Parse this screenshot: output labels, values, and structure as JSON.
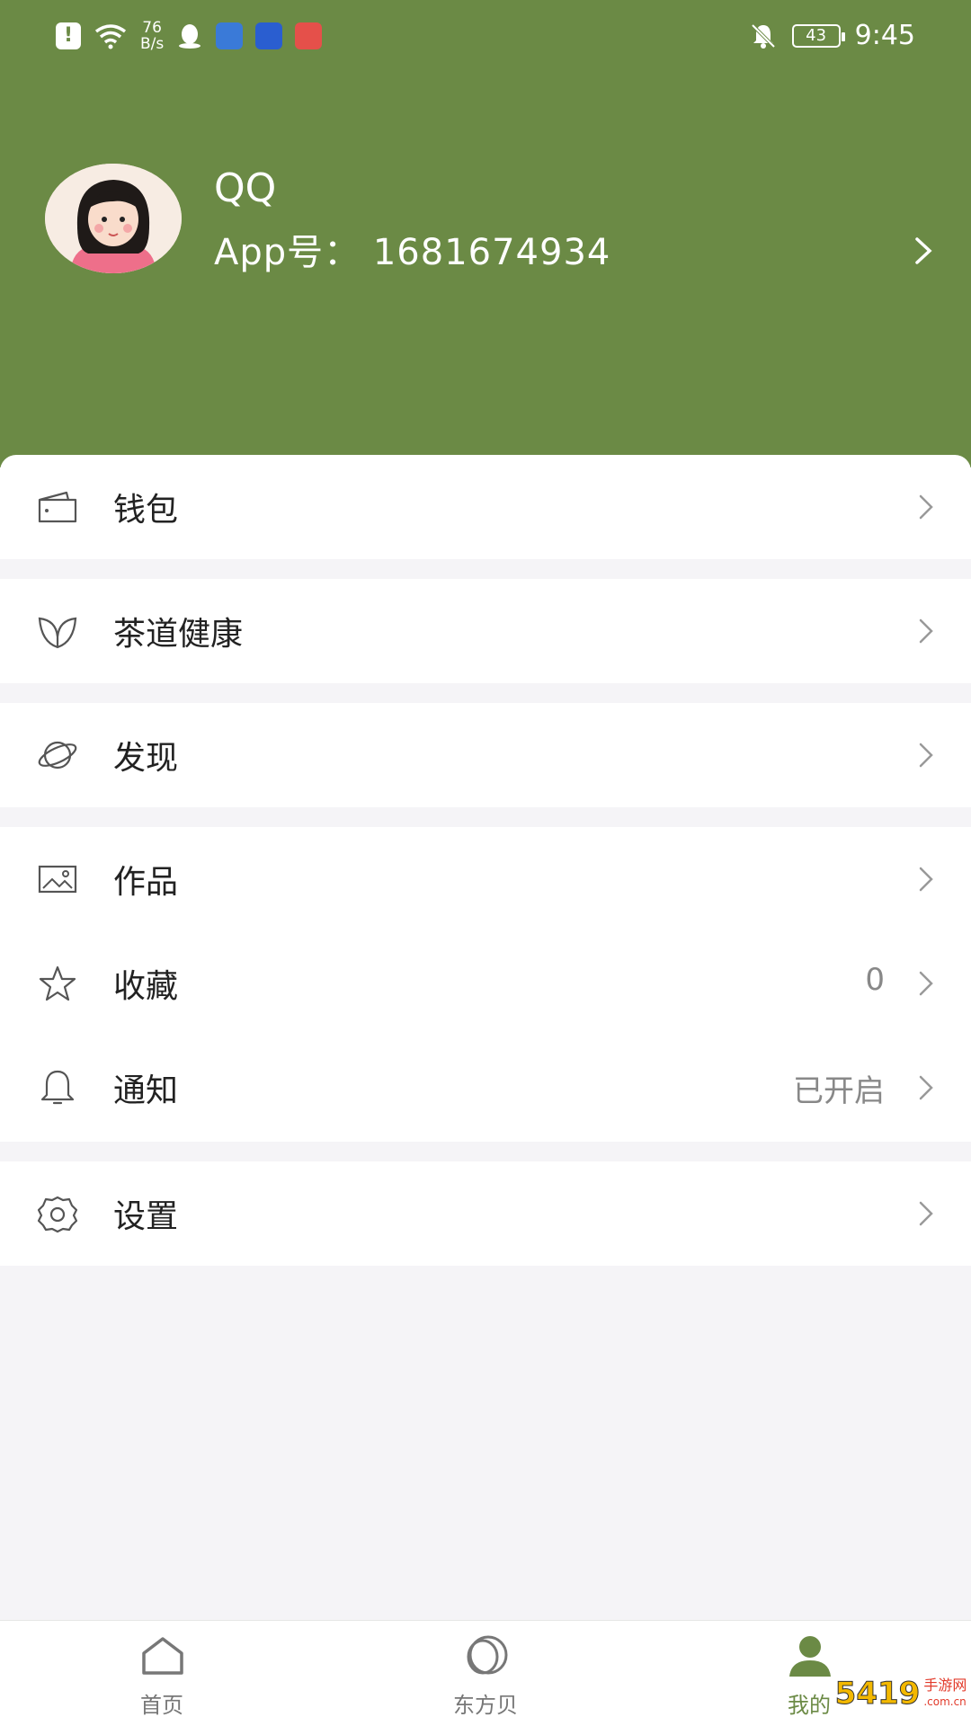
{
  "status_bar": {
    "speed_top": "76",
    "speed_bottom": "B/s",
    "battery": "43",
    "time": "9:45"
  },
  "profile": {
    "name": "QQ",
    "app_id": "App号：  1681674934"
  },
  "menu": {
    "wallet": "钱包",
    "tea_health": "茶道健康",
    "discover": "发现",
    "works": "作品",
    "favorites": "收藏",
    "favorites_count": "0",
    "notifications": "通知",
    "notifications_state": "已开启",
    "settings": "设置"
  },
  "tabbar": {
    "home": "首页",
    "dongfangbei": "东方贝",
    "mine": "我的"
  },
  "watermark": {
    "digits": "5419",
    "text_top": "手游网",
    "text_bottom": ".com.cn"
  },
  "colors": {
    "header": "#6b8a45",
    "active_tab": "#6b8a45",
    "background": "#f5f4f7"
  }
}
